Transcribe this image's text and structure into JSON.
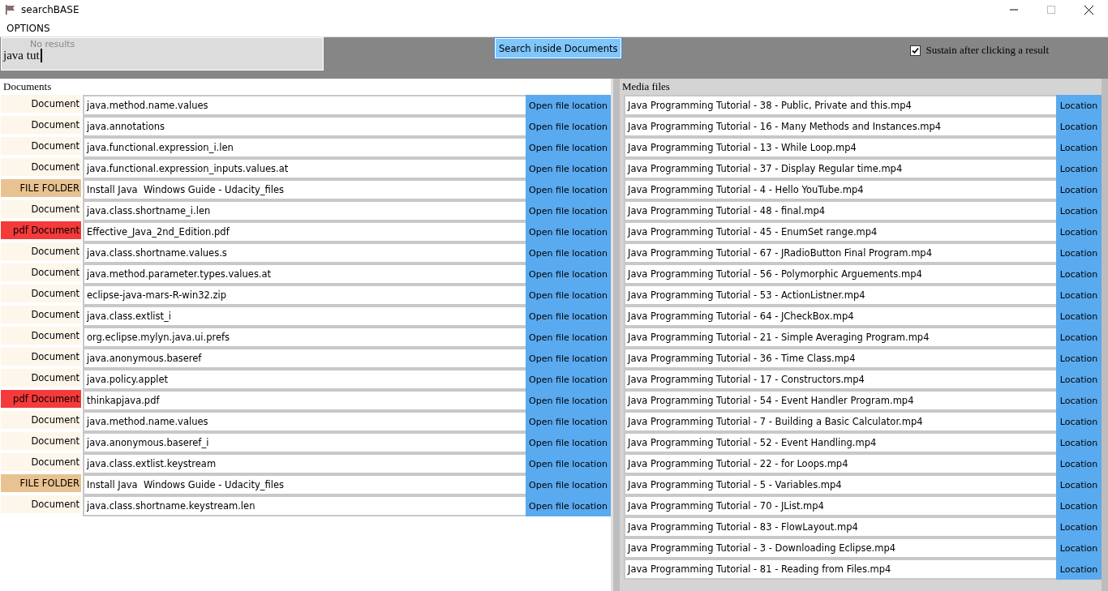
{
  "window": {
    "title": "searchBASE"
  },
  "menu": [
    "OPTIONS"
  ],
  "search": {
    "status": "No results",
    "value": "java tut"
  },
  "search_inside_button": "Search inside Documents",
  "sustain_checkbox": {
    "label": "Sustain after clicking a result",
    "checked": true
  },
  "documents": {
    "heading": "Documents",
    "rows": [
      {
        "kind": "document",
        "type": "Document",
        "name": "java.method.name.values",
        "action": "Open file location"
      },
      {
        "kind": "document",
        "type": "Document",
        "name": "java.annotations",
        "action": "Open file location"
      },
      {
        "kind": "document",
        "type": "Document",
        "name": "java.functional.expression_i.len",
        "action": "Open file location"
      },
      {
        "kind": "document",
        "type": "Document",
        "name": "java.functional.expression_inputs.values.at",
        "action": "Open file location"
      },
      {
        "kind": "folder",
        "type": "FILE FOLDER",
        "name": "Install Java  Windows Guide - Udacity_files",
        "action": "Open file location"
      },
      {
        "kind": "document",
        "type": "Document",
        "name": "java.class.shortname_i.len",
        "action": "Open file location"
      },
      {
        "kind": "pdf",
        "type": "pdf Document",
        "name": "Effective_Java_2nd_Edition.pdf",
        "action": "Open file location"
      },
      {
        "kind": "document",
        "type": "Document",
        "name": "java.class.shortname.values.s",
        "action": "Open file location"
      },
      {
        "kind": "document",
        "type": "Document",
        "name": "java.method.parameter.types.values.at",
        "action": "Open file location"
      },
      {
        "kind": "document",
        "type": "Document",
        "name": "eclipse-java-mars-R-win32.zip",
        "action": "Open file location"
      },
      {
        "kind": "document",
        "type": "Document",
        "name": "java.class.extlist_i",
        "action": "Open file location"
      },
      {
        "kind": "document",
        "type": "Document",
        "name": "org.eclipse.mylyn.java.ui.prefs",
        "action": "Open file location"
      },
      {
        "kind": "document",
        "type": "Document",
        "name": "java.anonymous.baseref",
        "action": "Open file location"
      },
      {
        "kind": "document",
        "type": "Document",
        "name": "java.policy.applet",
        "action": "Open file location"
      },
      {
        "kind": "pdf",
        "type": "pdf Document",
        "name": "thinkapjava.pdf",
        "action": "Open file location"
      },
      {
        "kind": "document",
        "type": "Document",
        "name": "java.method.name.values",
        "action": "Open file location"
      },
      {
        "kind": "document",
        "type": "Document",
        "name": "java.anonymous.baseref_i",
        "action": "Open file location"
      },
      {
        "kind": "document",
        "type": "Document",
        "name": "java.class.extlist.keystream",
        "action": "Open file location"
      },
      {
        "kind": "folder",
        "type": "FILE FOLDER",
        "name": "Install Java  Windows Guide - Udacity_files",
        "action": "Open file location"
      },
      {
        "kind": "document",
        "type": "Document",
        "name": "java.class.shortname.keystream.len",
        "action": "Open file location"
      }
    ]
  },
  "media": {
    "heading": "Media files",
    "rows": [
      {
        "name": "Java Programming Tutorial - 38 - Public, Private and this.mp4",
        "action": "Location"
      },
      {
        "name": "Java Programming Tutorial - 16 - Many Methods and Instances.mp4",
        "action": "Location"
      },
      {
        "name": "Java Programming Tutorial - 13 - While Loop.mp4",
        "action": "Location"
      },
      {
        "name": "Java Programming Tutorial - 37 - Display Regular time.mp4",
        "action": "Location"
      },
      {
        "name": "Java Programming Tutorial - 4 - Hello YouTube.mp4",
        "action": "Location"
      },
      {
        "name": "Java Programming Tutorial - 48 - final.mp4",
        "action": "Location"
      },
      {
        "name": "Java Programming Tutorial - 45 - EnumSet range.mp4",
        "action": "Location"
      },
      {
        "name": "Java Programming Tutorial - 67 - JRadioButton Final Program.mp4",
        "action": "Location"
      },
      {
        "name": "Java Programming Tutorial - 56 - Polymorphic Arguements.mp4",
        "action": "Location"
      },
      {
        "name": "Java Programming Tutorial - 53 - ActionListner.mp4",
        "action": "Location"
      },
      {
        "name": "Java Programming Tutorial - 64 - JCheckBox.mp4",
        "action": "Location"
      },
      {
        "name": "Java Programming Tutorial - 21 - Simple Averaging Program.mp4",
        "action": "Location"
      },
      {
        "name": "Java Programming Tutorial - 36 - Time Class.mp4",
        "action": "Location"
      },
      {
        "name": "Java Programming Tutorial - 17 - Constructors.mp4",
        "action": "Location"
      },
      {
        "name": "Java Programming Tutorial - 54 - Event Handler Program.mp4",
        "action": "Location"
      },
      {
        "name": "Java Programming Tutorial - 7 - Building a Basic Calculator.mp4",
        "action": "Location"
      },
      {
        "name": "Java Programming Tutorial - 52 - Event Handling.mp4",
        "action": "Location"
      },
      {
        "name": "Java Programming Tutorial - 22 - for Loops.mp4",
        "action": "Location"
      },
      {
        "name": "Java Programming Tutorial - 5 - Variables.mp4",
        "action": "Location"
      },
      {
        "name": "Java Programming Tutorial - 70 - JList.mp4",
        "action": "Location"
      },
      {
        "name": "Java Programming Tutorial - 83 - FlowLayout.mp4",
        "action": "Location"
      },
      {
        "name": "Java Programming Tutorial - 3 - Downloading Eclipse.mp4",
        "action": "Location"
      },
      {
        "name": "Java Programming Tutorial - 81 - Reading from Files.mp4",
        "action": "Location"
      }
    ]
  }
}
